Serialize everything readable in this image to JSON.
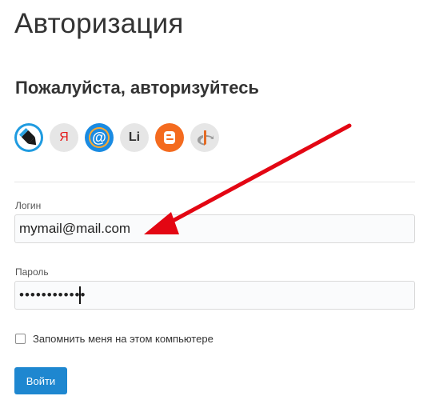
{
  "page": {
    "title": "Авторизация",
    "subtitle": "Пожалуйста, авторизуйтесь"
  },
  "providers": [
    {
      "icon": "livejournal-icon",
      "color": "#1f9be0"
    },
    {
      "icon": "yandex-icon",
      "color": "#e31c1c",
      "letter": "Я"
    },
    {
      "icon": "mailru-icon",
      "color": "#1a8be2"
    },
    {
      "icon": "liveinternet-icon",
      "color": "#333333",
      "letter": "Li"
    },
    {
      "icon": "blogger-icon",
      "color": "#f46b1f"
    },
    {
      "icon": "openid-icon",
      "color": "#e46b24"
    }
  ],
  "form": {
    "login_label": "Логин",
    "login_value": "mymail@mail.com",
    "password_label": "Пароль",
    "password_value": "••••••••••••",
    "remember_label": "Запомнить меня на этом компьютере",
    "remember_checked": false,
    "submit_label": "Войти"
  },
  "colors": {
    "accent": "#1e87d0",
    "arrow": "#e30613"
  }
}
